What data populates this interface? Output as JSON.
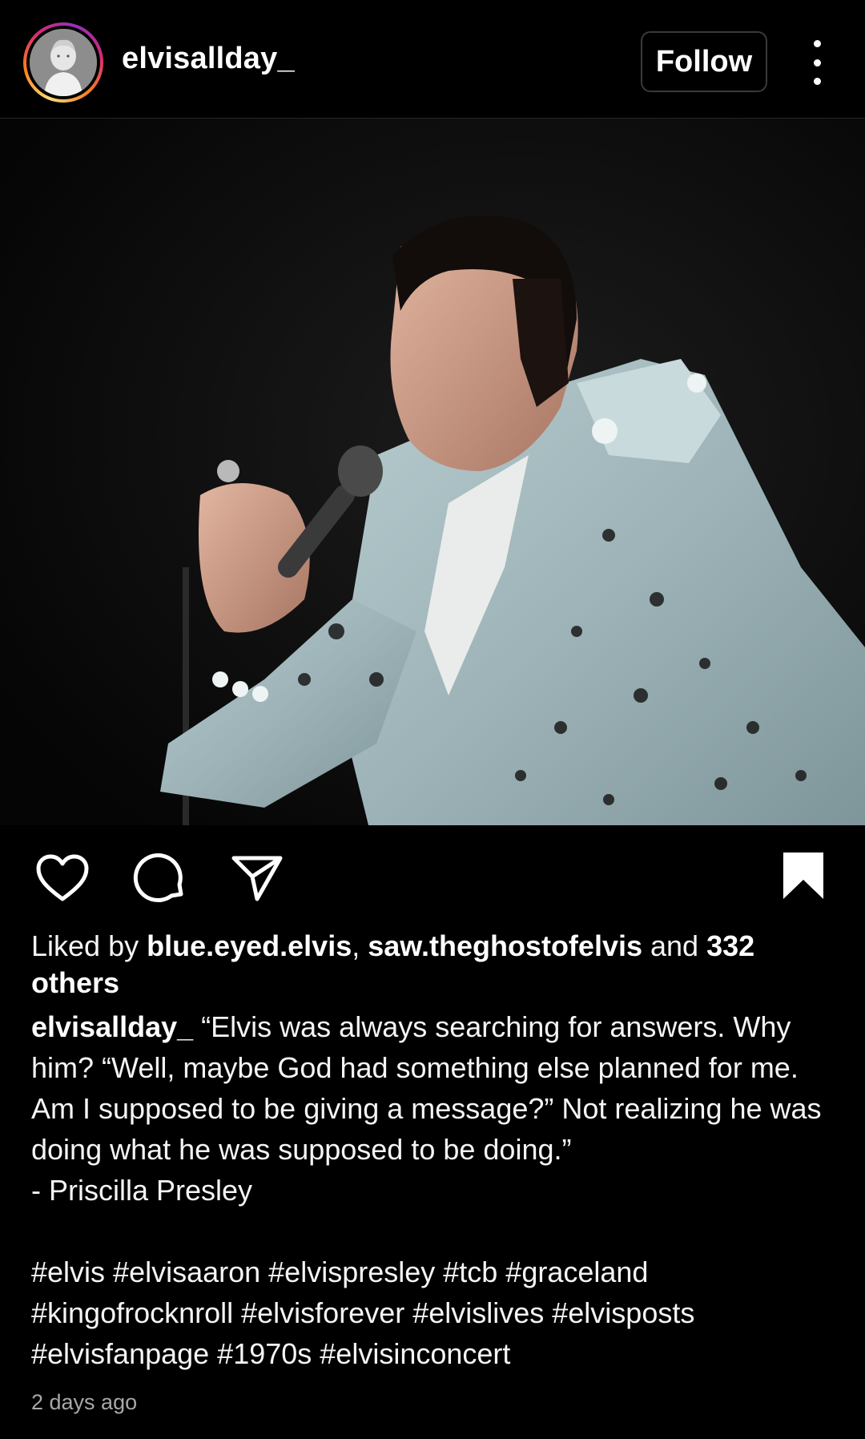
{
  "post": {
    "header": {
      "username": "elvisallday_",
      "follow_label": "Follow",
      "more_icon": "more-vertical-icon"
    },
    "photo": {
      "alt": "Elvis singing into a microphone in a studded white jumpsuit"
    },
    "actions": {
      "like_icon": "heart-icon",
      "comment_icon": "comment-icon",
      "share_icon": "send-icon",
      "save_icon": "bookmark-icon"
    },
    "likes": {
      "prefix": "Liked by ",
      "user1": "blue.eyed.elvis",
      "separator": ", ",
      "user2": "saw.theghostofelvis",
      "conjunction": " and ",
      "others": "332 others"
    },
    "caption": {
      "username": "elvisallday_",
      "text": " “Elvis was always searching for answers. Why him? “Well, maybe God had something else planned for me. Am I supposed to be giving a message?” Not realizing he was doing what he was supposed to be doing.”\n- Priscilla Presley",
      "hashtags": "#elvis #elvisaaron #elvispresley #tcb #graceland #kingofrocknroll #elvisforever #elvislives #elvisposts #elvisfanpage #1970s #elvisinconcert"
    },
    "timestamp": "2 days ago"
  },
  "colors": {
    "background": "#000000",
    "text": "#f5f5f5",
    "muted": "#a8a8a8",
    "border": "#3a3a3a"
  }
}
